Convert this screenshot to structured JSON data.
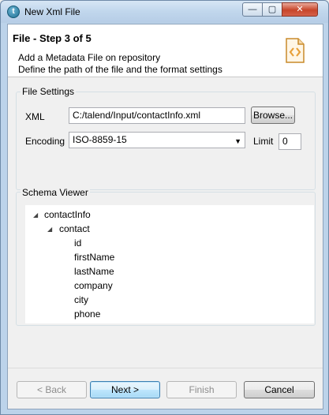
{
  "window": {
    "title": "New Xml File",
    "controls": {
      "minimize": "—",
      "maximize": "▢",
      "close": "✕"
    }
  },
  "header": {
    "step_title": "File - Step 3 of 5",
    "description_line1": "Add a Metadata File on repository",
    "description_line2": "Define the path of the file and the format settings"
  },
  "file_settings": {
    "group_label": "File Settings",
    "xml_label": "XML",
    "xml_value": "C:/talend/Input/contactInfo.xml",
    "browse_label": "Browse...",
    "encoding_label": "Encoding",
    "encoding_value": "ISO-8859-15",
    "limit_label": "Limit",
    "limit_value": "0"
  },
  "schema_viewer": {
    "group_label": "Schema Viewer",
    "root": "contactInfo",
    "child": "contact",
    "fields": [
      "id",
      "firstName",
      "lastName",
      "company",
      "city",
      "phone"
    ]
  },
  "footer": {
    "back_label": "< Back",
    "next_label": "Next >",
    "finish_label": "Finish",
    "cancel_label": "Cancel"
  },
  "colors": {
    "accent": "#3c7fb1",
    "file_icon_orange": "#e8a03a"
  }
}
